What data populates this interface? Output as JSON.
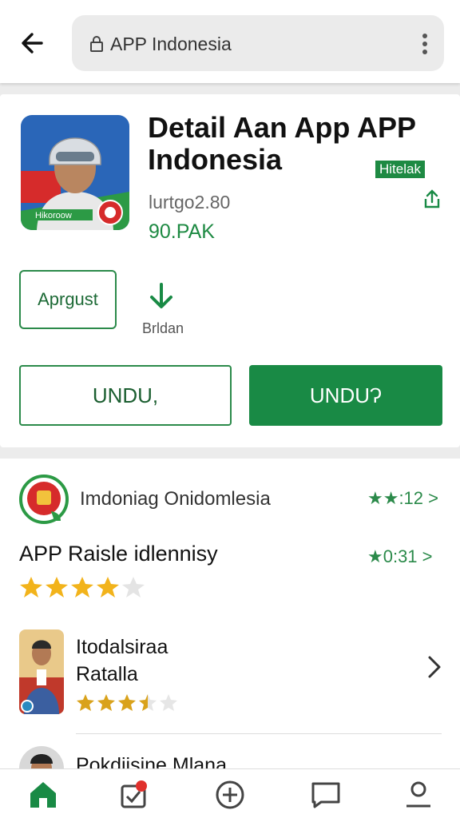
{
  "browser": {
    "url_text": "APP Indonesia",
    "back_icon": "arrow-left-icon",
    "lock_icon": "lock-icon",
    "menu_icon": "kebab-menu-icon"
  },
  "app": {
    "title": "Detail Aan App APP Indonesia",
    "badge": "Hitelak",
    "meta": "lurtgo2.80",
    "price": "90.PAK",
    "icon_caption": "Hikoroow",
    "tag_button": "Aprgust",
    "download_label": "Brldan",
    "button_outline": "UNDU,",
    "button_fill": "UNDUɁ",
    "accent_color": "#198a45"
  },
  "developer": {
    "name": "Imdoniag Onidomlesia",
    "rating": "★★:12 >"
  },
  "reviews": {
    "title": "APP Raisle idlennisy",
    "rating": "★0:31 >",
    "stars": 4,
    "items": [
      {
        "name_line1": "Itodalsiraa",
        "name_line2": "Ratalla",
        "stars": 3.5
      },
      {
        "name_line1": "Pokdijsine Mlana"
      }
    ]
  },
  "bottom_nav": [
    "home-icon",
    "inbox-badge-icon",
    "add-circle-icon",
    "chat-icon",
    "profile-icon"
  ]
}
